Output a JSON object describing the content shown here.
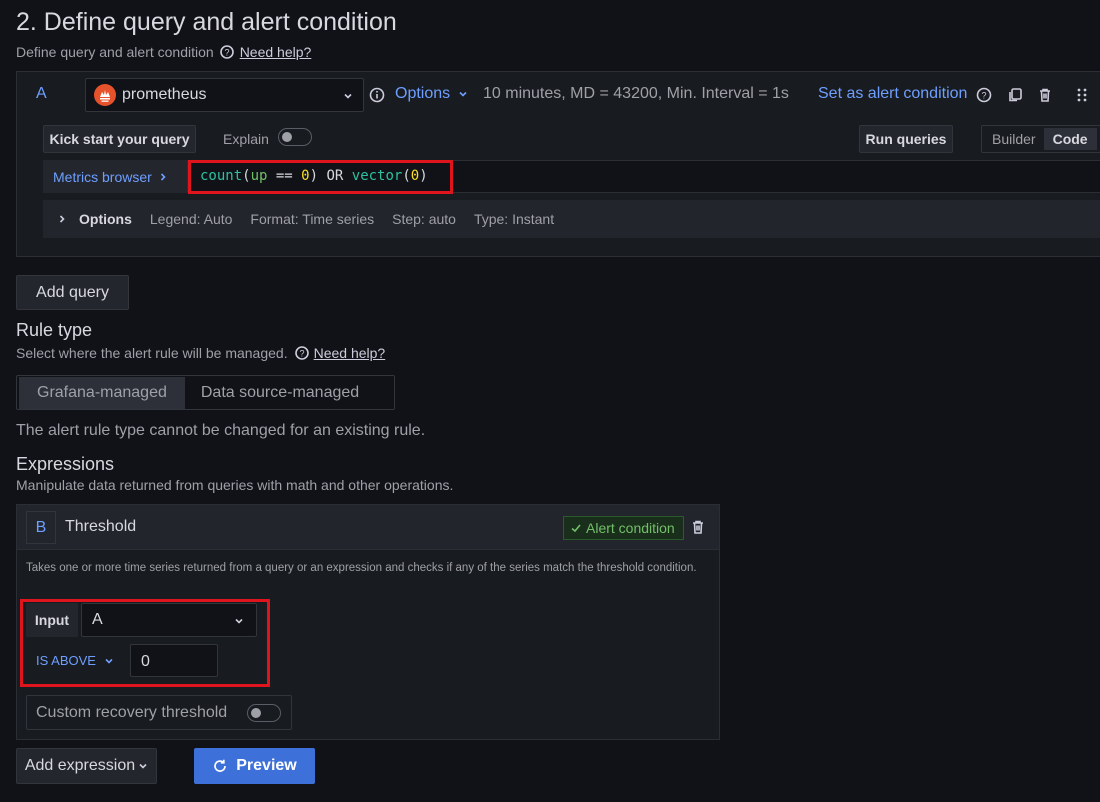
{
  "section": {
    "title": "2. Define query and alert condition",
    "subtitle": "Define query and alert condition",
    "help": "Need help?"
  },
  "query": {
    "ref": "A",
    "datasource": "prometheus",
    "options_label": "Options",
    "options_summary": "10 minutes, MD = 43200, Min. Interval = 1s",
    "set_alert": "Set as alert condition",
    "kick_start": "Kick start your query",
    "explain": "Explain",
    "run_queries": "Run queries",
    "builder": "Builder",
    "code": "Code",
    "metrics_browser": "Metrics browser",
    "expr_parts": [
      "count",
      "(",
      "up",
      " == ",
      "0",
      ") OR ",
      "vector",
      "(",
      "0",
      ")"
    ],
    "opts": {
      "label": "Options",
      "legend": "Legend: Auto",
      "format": "Format: Time series",
      "step": "Step: auto",
      "type": "Type: Instant"
    }
  },
  "add_query": "Add query",
  "rule_type": {
    "title": "Rule type",
    "desc": "Select where the alert rule will be managed.",
    "help": "Need help?",
    "options": [
      "Grafana-managed",
      "Data source-managed"
    ],
    "note": "The alert rule type cannot be changed for an existing rule."
  },
  "expressions": {
    "title": "Expressions",
    "desc": "Manipulate data returned from queries with math and other operations.",
    "card": {
      "ref": "B",
      "name": "Threshold",
      "badge": "Alert condition",
      "description": "Takes one or more time series returned from a query or an expression and checks if any of the series match the threshold condition.",
      "input_label": "Input",
      "input_value": "A",
      "condition": "IS ABOVE",
      "threshold": "0",
      "recovery": "Custom recovery threshold"
    }
  },
  "footer": {
    "add_expression": "Add expression",
    "preview": "Preview"
  },
  "colors": {
    "accent": "#6e9fff",
    "primary_button": "#3d71d9",
    "alert_badge": "#73bf69",
    "highlight": "#e0141c"
  }
}
